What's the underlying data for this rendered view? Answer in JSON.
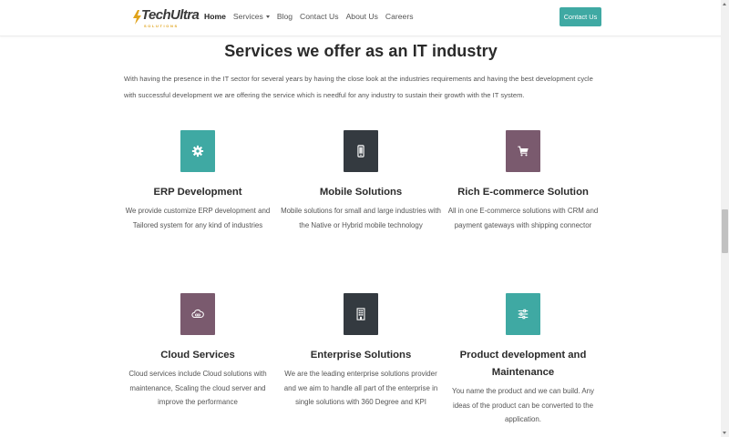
{
  "brand": {
    "name": "TechUltra",
    "tagline": "SOLUTIONS",
    "accent": "#e0a31b",
    "primary": "#3fa9a3"
  },
  "nav": {
    "links": [
      {
        "label": "Home",
        "active": true
      },
      {
        "label": "Services",
        "dropdown": true
      },
      {
        "label": "Blog"
      },
      {
        "label": "Contact Us"
      },
      {
        "label": "About Us"
      },
      {
        "label": "Careers"
      }
    ],
    "cta_label": "Contact Us"
  },
  "section": {
    "title": "Services we offer as an IT industry",
    "intro": "With having the presence in the IT sector for several years by having the close look at the industries requirements and having the best development cycle with successful development we are offering the service which is needful for any industry to sustain their growth with the IT system."
  },
  "services": [
    {
      "icon": "gear-icon",
      "tile_color": "#3fa9a3",
      "title": "ERP Development",
      "description": "We provide customize ERP development and Tailored system for any kind of industries"
    },
    {
      "icon": "mobile-phone-icon",
      "tile_color": "#343a40",
      "title": "Mobile Solutions",
      "description": "Mobile solutions for small and large industries with the Native or Hybrid mobile technology"
    },
    {
      "icon": "shopping-cart-icon",
      "tile_color": "#7a5a6e",
      "title": "Rich E-commerce Solution",
      "description": "All in one E-commerce solutions with CRM and payment gateways with shipping connector"
    },
    {
      "icon": "cloud-link-icon",
      "tile_color": "#7a5a6e",
      "title": "Cloud Services",
      "description": "Cloud services include Cloud solutions with maintenance, Scaling the cloud server and improve the performance"
    },
    {
      "icon": "building-icon",
      "tile_color": "#343a40",
      "title": "Enterprise Solutions",
      "description": "We are the leading enterprise solutions provider and we aim to handle all part of the enterprise in single solutions with 360 Degree and KPI"
    },
    {
      "icon": "sliders-icon",
      "tile_color": "#3fa9a3",
      "title": "Product development and Maintenance",
      "description": "You name the product and we can build. Any ideas of the product can be converted to the application."
    }
  ]
}
